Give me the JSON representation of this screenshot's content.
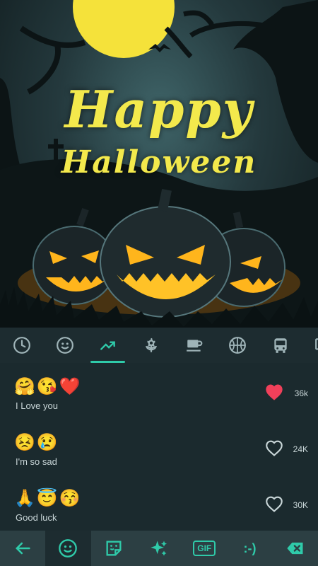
{
  "hero": {
    "line1": "Happy",
    "line2": "Halloween"
  },
  "tabs": [
    {
      "icon": "recent-clock-icon",
      "active": false
    },
    {
      "icon": "smiley-icon",
      "active": false
    },
    {
      "icon": "trending-icon",
      "active": true
    },
    {
      "icon": "flower-icon",
      "active": false
    },
    {
      "icon": "coffee-cup-icon",
      "active": false
    },
    {
      "icon": "basketball-icon",
      "active": false
    },
    {
      "icon": "bus-icon",
      "active": false
    },
    {
      "icon": "device-icon",
      "active": false
    }
  ],
  "combos": [
    {
      "emojis": [
        "🤗",
        "😘",
        "❤️"
      ],
      "caption": "I Love you",
      "liked": true,
      "count": "36k"
    },
    {
      "emojis": [
        "😣",
        "😢"
      ],
      "caption": "I'm so sad",
      "liked": false,
      "count": "24K"
    },
    {
      "emojis": [
        "🙏",
        "😇",
        "😚"
      ],
      "caption": "Good luck",
      "liked": false,
      "count": "30K"
    }
  ],
  "bottom_bar": {
    "gif_label": "GIF",
    "kaomoji_label": ":-)"
  },
  "colors": {
    "accent": "#2fcaa9",
    "like": "#f0405a",
    "title": "#f3e94c",
    "panel": "#1b2a2e"
  }
}
